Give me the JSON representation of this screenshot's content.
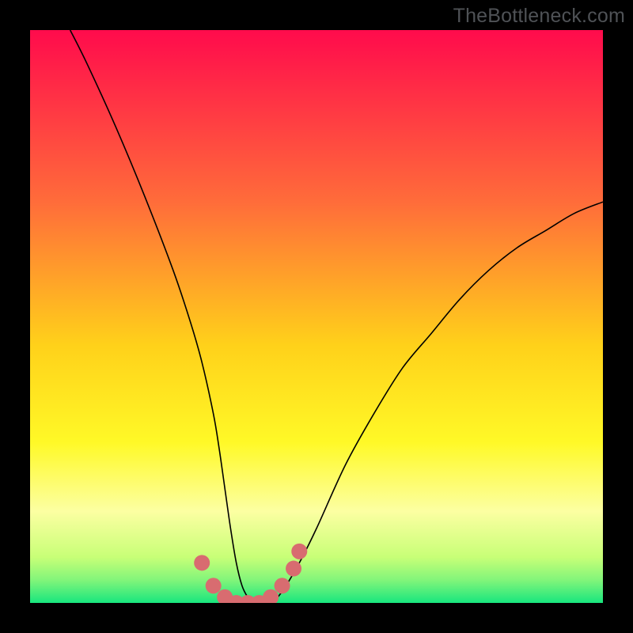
{
  "watermark": "TheBottleneck.com",
  "chart_data": {
    "type": "line",
    "title": "",
    "xlabel": "",
    "ylabel": "",
    "xlim": [
      0,
      100
    ],
    "ylim": [
      0,
      100
    ],
    "grid": false,
    "legend": false,
    "series": [
      {
        "name": "curve",
        "color": "#000000",
        "x": [
          7,
          10,
          15,
          20,
          25,
          28,
          30,
          32,
          33,
          34,
          35,
          36,
          37,
          38,
          39,
          40,
          42,
          44,
          47,
          50,
          55,
          60,
          65,
          70,
          75,
          80,
          85,
          90,
          95,
          100
        ],
        "y": [
          100,
          94,
          83,
          71,
          58,
          49,
          42,
          33,
          27,
          20,
          13,
          7,
          3,
          1,
          0,
          0,
          0,
          2,
          7,
          13,
          24,
          33,
          41,
          47,
          53,
          58,
          62,
          65,
          68,
          70
        ]
      },
      {
        "name": "valley-markers",
        "color": "#d86c70",
        "marker_size": 10,
        "x": [
          30,
          32,
          34,
          36,
          38,
          40,
          42,
          44,
          46,
          47
        ],
        "y": [
          7,
          3,
          1,
          0,
          0,
          0,
          1,
          3,
          6,
          9
        ]
      }
    ],
    "background_gradient": {
      "stops": [
        {
          "pos": 0.0,
          "color": "#ff0b4c"
        },
        {
          "pos": 0.3,
          "color": "#ff6c3a"
        },
        {
          "pos": 0.55,
          "color": "#ffd11a"
        },
        {
          "pos": 0.72,
          "color": "#fff927"
        },
        {
          "pos": 0.84,
          "color": "#fcffa2"
        },
        {
          "pos": 0.92,
          "color": "#c8ff77"
        },
        {
          "pos": 0.96,
          "color": "#82f57a"
        },
        {
          "pos": 1.0,
          "color": "#18e67e"
        }
      ]
    }
  }
}
